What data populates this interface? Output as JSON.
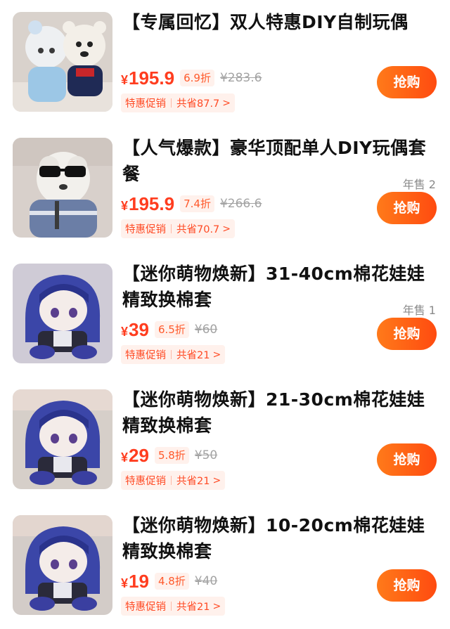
{
  "products": [
    {
      "title": "【专属回忆】双人特惠DIY自制玩偶",
      "currency": "¥",
      "price": "195.9",
      "discount": "6.9折",
      "original_price": "¥283.6",
      "promo_tag": "特惠促销",
      "promo_saving": "共省87.7",
      "sales": "",
      "buy_label": "抢购",
      "image": "two-plush-dolls-photo"
    },
    {
      "title": "【人气爆款】豪华顶配单人DIY玩偶套餐",
      "currency": "¥",
      "price": "195.9",
      "discount": "7.4折",
      "original_price": "¥266.6",
      "promo_tag": "特惠促销",
      "promo_saving": "共省70.7",
      "sales": "年售 2",
      "buy_label": "抢购",
      "image": "dog-plush-sunglasses-photo"
    },
    {
      "title": "【迷你萌物焕新】31-40cm棉花娃娃精致换棉套",
      "currency": "¥",
      "price": "39",
      "discount": "6.5折",
      "original_price": "¥60",
      "promo_tag": "特惠促销",
      "promo_saving": "共省21",
      "sales": "年售 1",
      "buy_label": "抢购",
      "image": "blue-hair-cotton-doll-photo"
    },
    {
      "title": "【迷你萌物焕新】21-30cm棉花娃娃精致换棉套",
      "currency": "¥",
      "price": "29",
      "discount": "5.8折",
      "original_price": "¥50",
      "promo_tag": "特惠促销",
      "promo_saving": "共省21",
      "sales": "",
      "buy_label": "抢购",
      "image": "blue-hair-cotton-doll-photo"
    },
    {
      "title": "【迷你萌物焕新】10-20cm棉花娃娃精致换棉套",
      "currency": "¥",
      "price": "19",
      "discount": "4.8折",
      "original_price": "¥40",
      "promo_tag": "特惠促销",
      "promo_saving": "共省21",
      "sales": "",
      "buy_label": "抢购",
      "image": "blue-hair-cotton-doll-photo"
    }
  ],
  "colors": {
    "accent": "#ff4b10",
    "price": "#ff3d1f",
    "promo_bg": "#fff1ec"
  }
}
